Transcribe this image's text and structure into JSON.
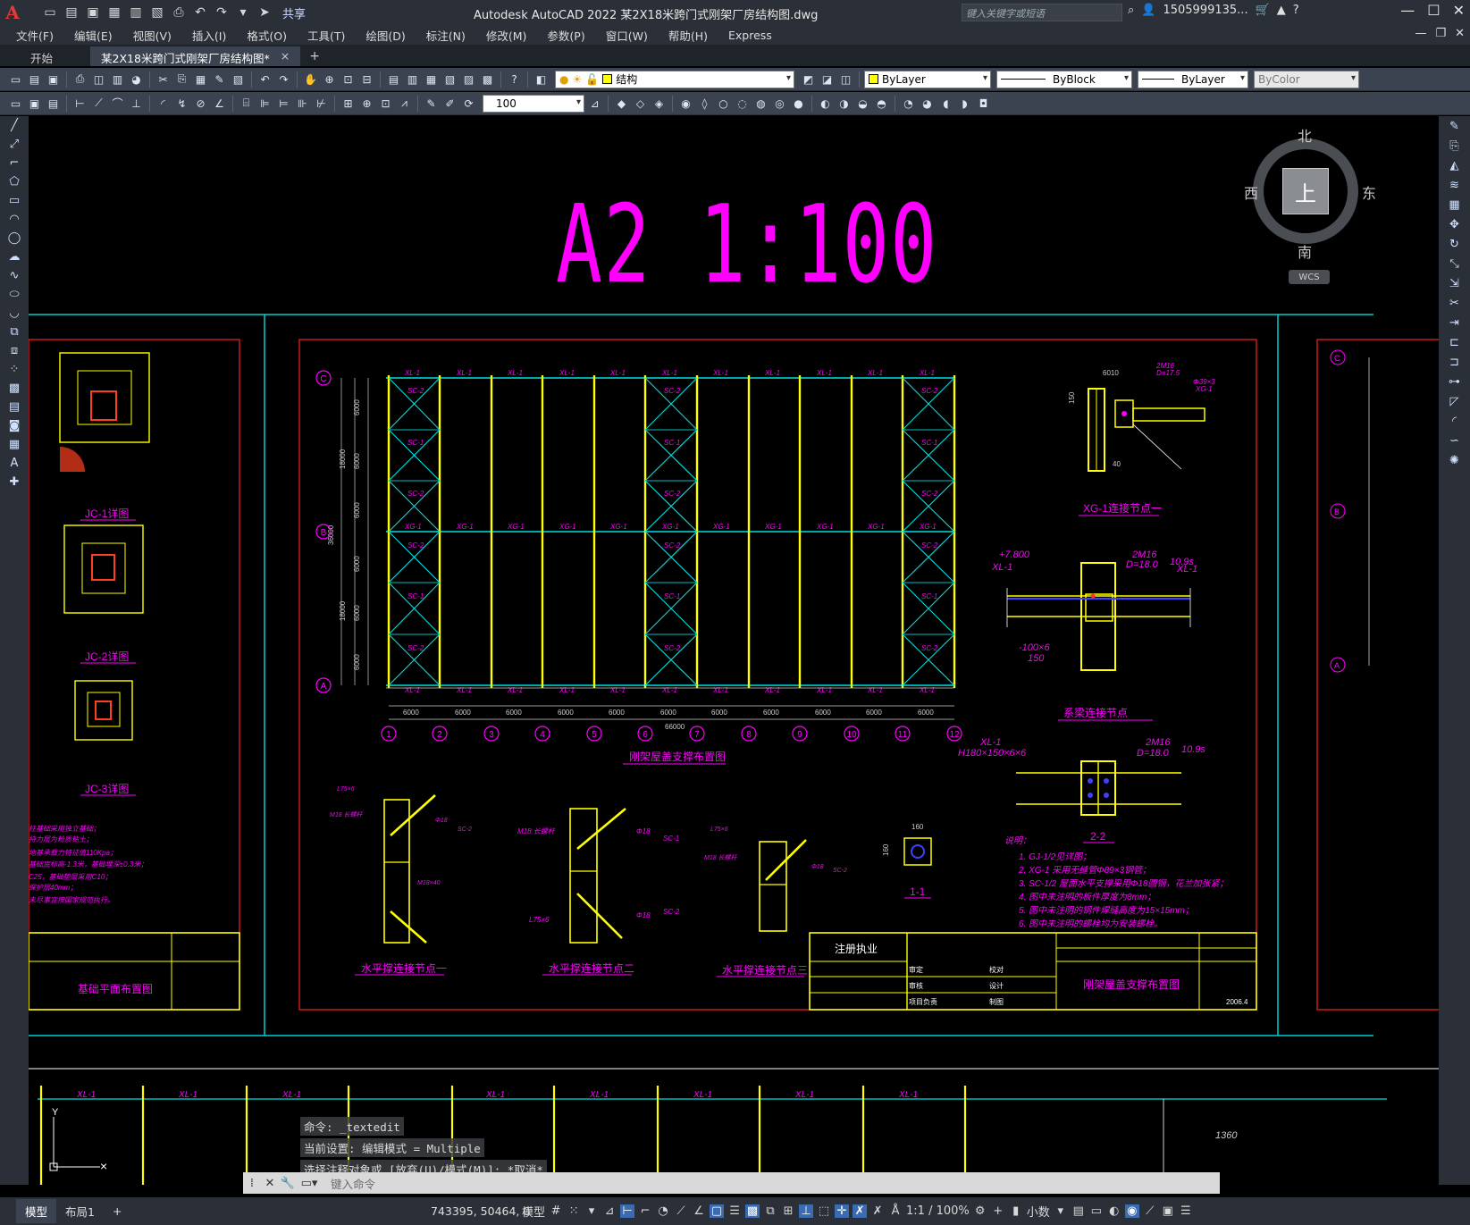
{
  "app": {
    "title": "Autodesk AutoCAD 2022    某2X18米跨门式刚架厂房结构图.dwg",
    "share_label": "共享",
    "search_placeholder": "键入关键字或短语",
    "user": "1505999135...",
    "logo": "A"
  },
  "menu": [
    "文件(F)",
    "编辑(E)",
    "视图(V)",
    "插入(I)",
    "格式(O)",
    "工具(T)",
    "绘图(D)",
    "标注(N)",
    "修改(M)",
    "参数(P)",
    "窗口(W)",
    "帮助(H)",
    "Express"
  ],
  "tabs": {
    "start": "开始",
    "active": "某2X18米跨门式刚架厂房结构图*",
    "close": "×",
    "add": "+"
  },
  "toolbar": {
    "layer_name": "结构",
    "color": "ByLayer",
    "linetype": "ByBlock",
    "lineweight": "ByLayer",
    "plotstyle": "ByColor",
    "scale_value": "100",
    "layer_color": "#ffff00"
  },
  "viewcube": {
    "north": "北",
    "south": "南",
    "east": "东",
    "west": "西",
    "face": "上",
    "wcs": "WCS"
  },
  "drawing": {
    "big_title": "A2  1:100",
    "plan_title": "刚架屋盖支撑布置图",
    "grid_numbers": [
      "1",
      "2",
      "3",
      "4",
      "5",
      "6",
      "7",
      "8",
      "9",
      "10",
      "11",
      "12"
    ],
    "grid_letters": [
      "C",
      "B",
      "A"
    ],
    "bay_dims": [
      "6000",
      "6000",
      "6000",
      "6000",
      "6000",
      "6000",
      "6000",
      "6000",
      "6000",
      "6000",
      "6000"
    ],
    "total_dim": "66000",
    "details": {
      "xg1": "XG-1连接节点一",
      "tie": "系梁连接节点",
      "sec22": "2-2",
      "sec11": "1-1",
      "h1": "水平撑连接节点一",
      "h2": "水平撑连接节点二",
      "h3": "水平撑连接节点三"
    },
    "foundation": {
      "jc1": "JC-1详图",
      "jc2": "JC-2详图",
      "jc3": "JC-3详图",
      "plan": "基础平面布置图"
    },
    "notes_title": "说明：",
    "notes": [
      "1. GJ-1/2见详图；",
      "2. XG-1 采用无缝管Φ89×3钢管；",
      "3. SC-1/2 屋面水平支撑采用Φ18圆钢，花兰加张紧；",
      "4. 图中未注明的板件厚度为8mm；",
      "5. 图中未注明的钢件焊缝高度为15×15mm；",
      "6. 图中未注明的螺栓均为安装螺栓。"
    ],
    "left_notes": [
      "柱基础采用独立基础；",
      "持力层为粉质粘土；",
      "地基承载力特征值110Kpa；",
      "基础底标高-1.3米，基础埋深±0.3米；",
      "C25，基础垫层采用C10；",
      "保护层40mm；",
      "未尽事宜按国家规范执行。"
    ],
    "titleblock": {
      "stamp": "注册执业",
      "drawing_name": "刚架屋盖支撑布置图",
      "rows": [
        "审定",
        "审核",
        "项目负责",
        "校对",
        "设计",
        "制图"
      ],
      "date": "2006.4"
    },
    "member_labels": {
      "xl1": "XL-1",
      "sc2": "SC-2",
      "sc1": "SC-1",
      "xg1": "XG-1",
      "gj1": "GJ-1"
    }
  },
  "command": {
    "history": [
      "命令: _textedit",
      "当前设置: 编辑模式 = Multiple",
      "选择注释对象或 [放弃(U)/模式(M)]: *取消*"
    ],
    "placeholder": "键入命令"
  },
  "status": {
    "model_tab": "模型",
    "layout_tab": "布局1",
    "add": "+",
    "coords": "743395, 50464, 0",
    "model_label": "模型",
    "scale": "1:1 / 100%",
    "units": "小数"
  }
}
